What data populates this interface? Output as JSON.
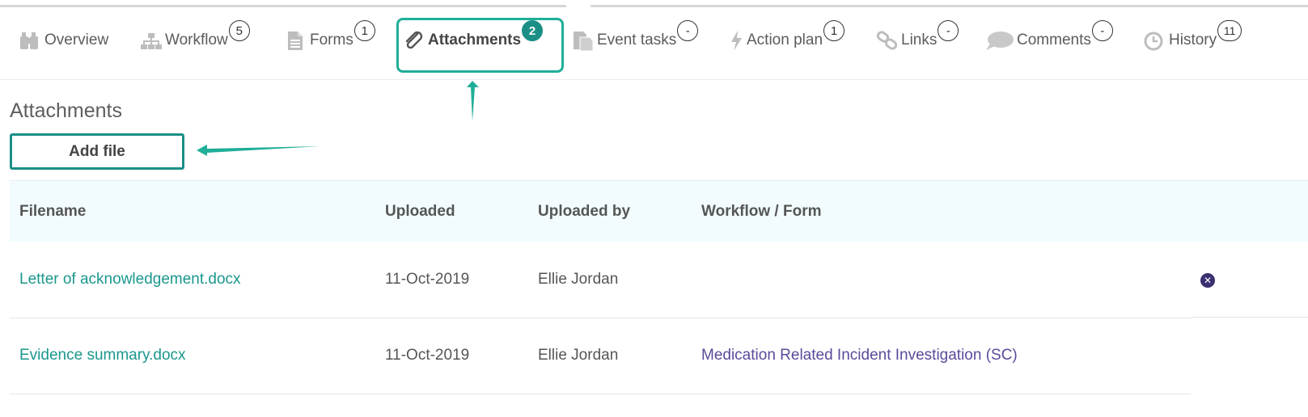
{
  "tabs": [
    {
      "label": "Overview",
      "icon": "binoculars-icon",
      "count": ""
    },
    {
      "label": "Workflow",
      "icon": "org-chart-icon",
      "count": "5"
    },
    {
      "label": "Forms",
      "icon": "document-icon",
      "count": "1"
    },
    {
      "label": "Attachments",
      "icon": "paperclip-icon",
      "count": "2",
      "active": true
    },
    {
      "label": "Event tasks",
      "icon": "tasks-icon",
      "count": "-"
    },
    {
      "label": "Action plan",
      "icon": "lightning-icon",
      "count": "1"
    },
    {
      "label": "Links",
      "icon": "chain-link-icon",
      "count": "-"
    },
    {
      "label": "Comments",
      "icon": "speech-bubble-icon",
      "count": "-"
    },
    {
      "label": "History",
      "icon": "clock-icon",
      "count": "11"
    }
  ],
  "section": {
    "title": "Attachments",
    "add_button": "Add file"
  },
  "table": {
    "headers": [
      "Filename",
      "Uploaded",
      "Uploaded by",
      "Workflow / Form"
    ],
    "rows": [
      {
        "filename": "Letter of acknowledgement.docx",
        "uploaded": "11-Oct-2019",
        "uploaded_by": "Ellie Jordan",
        "workflow_form": "",
        "has_delete": true
      },
      {
        "filename": "Evidence summary.docx",
        "uploaded": "11-Oct-2019",
        "uploaded_by": "Ellie Jordan",
        "workflow_form": "Medication Related Incident Investigation (SC)",
        "has_delete": false
      }
    ]
  },
  "colors": {
    "accent": "#1fae98",
    "link": "#1a978d",
    "form_link": "#5b4a9b",
    "header_bg": "#f2fcfe"
  }
}
